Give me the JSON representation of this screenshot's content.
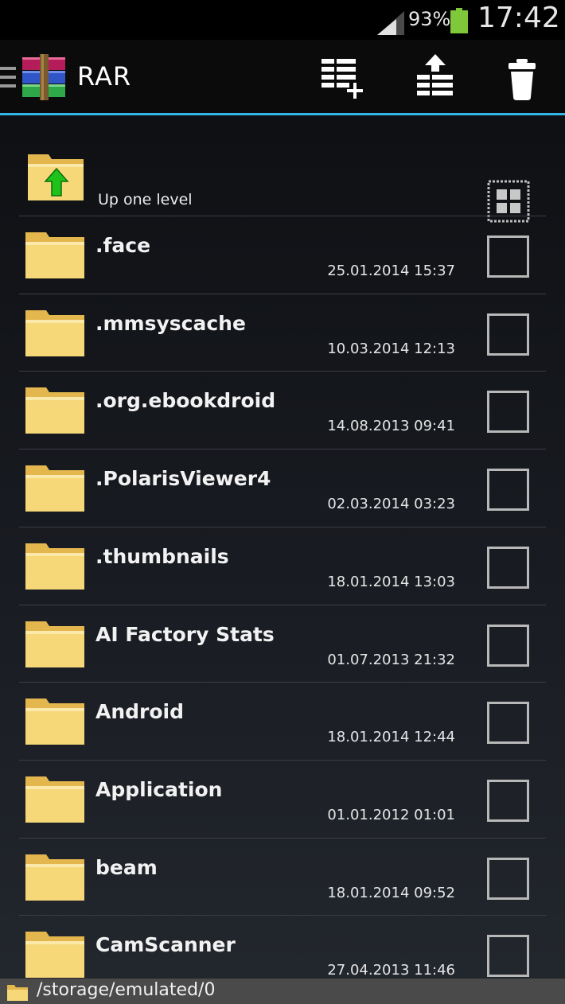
{
  "status": {
    "battery_percent": "93%",
    "time": "17:42",
    "battery_color": "#7ec83a"
  },
  "actionbar": {
    "title": "RAR",
    "accent": "#33b5e5",
    "buttons": [
      {
        "icon": "add-to-archive-icon"
      },
      {
        "icon": "extract-icon"
      },
      {
        "icon": "delete-icon"
      }
    ]
  },
  "list": {
    "up_label": "Up one level",
    "items": [
      {
        "name": ".face",
        "date": "25.01.2014 15:37"
      },
      {
        "name": ".mmsyscache",
        "date": "10.03.2014 12:13"
      },
      {
        "name": ".org.ebookdroid",
        "date": "14.08.2013 09:41"
      },
      {
        "name": ".PolarisViewer4",
        "date": "02.03.2014 03:23"
      },
      {
        "name": ".thumbnails",
        "date": "18.01.2014 13:03"
      },
      {
        "name": "AI Factory Stats",
        "date": "01.07.2013 21:32"
      },
      {
        "name": "Android",
        "date": "18.01.2014 12:44"
      },
      {
        "name": "Application",
        "date": "01.01.2012 01:01"
      },
      {
        "name": "beam",
        "date": "18.01.2014 09:52"
      },
      {
        "name": "CamScanner",
        "date": "27.04.2013 11:46"
      }
    ]
  },
  "path": "/storage/emulated/0"
}
